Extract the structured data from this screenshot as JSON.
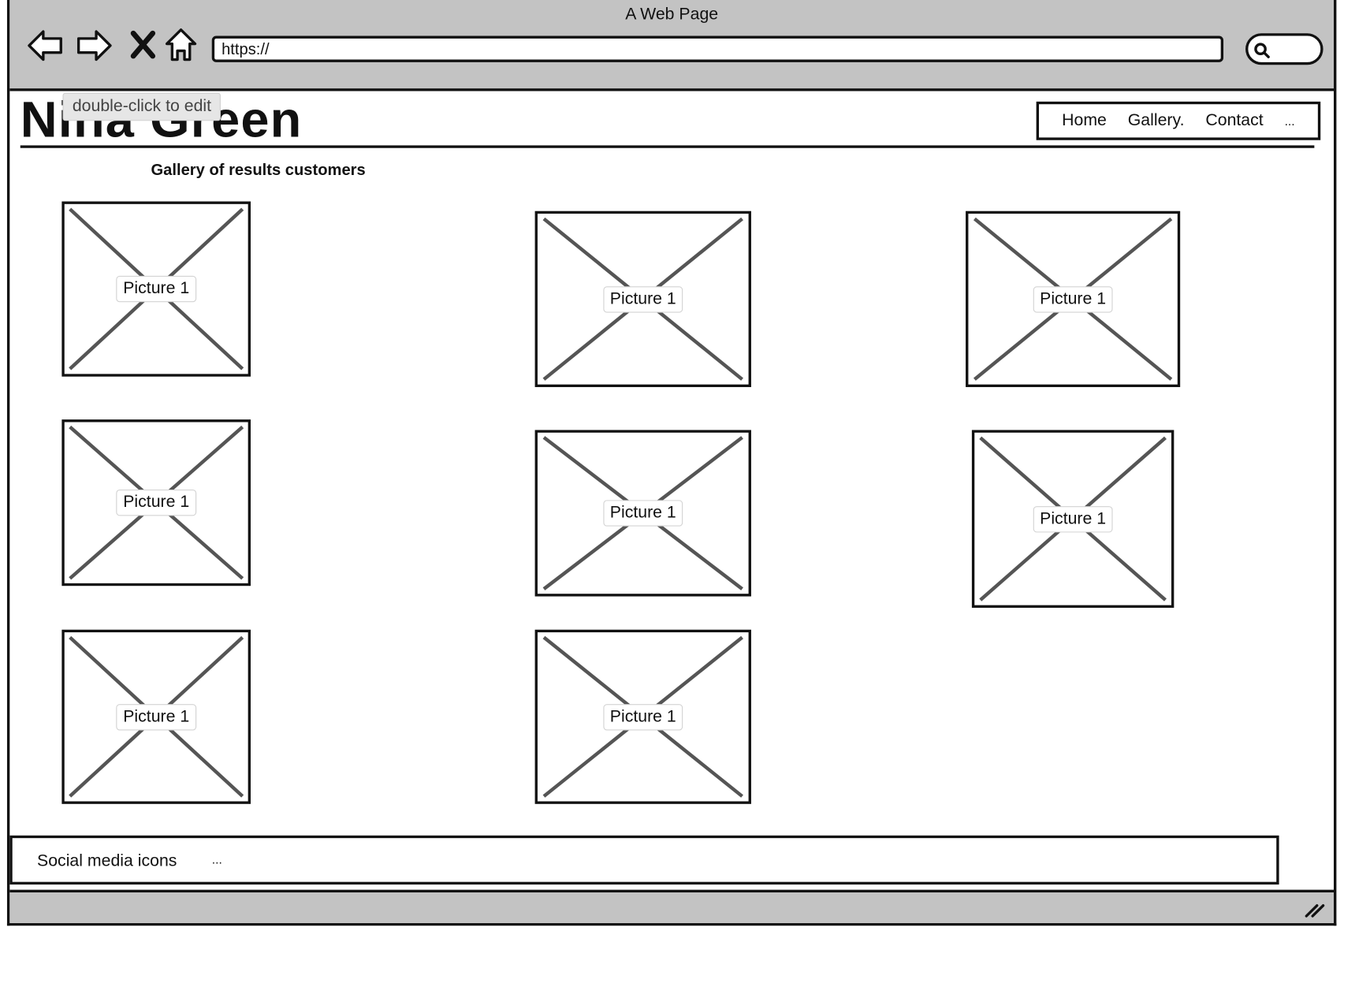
{
  "window": {
    "title": "A Web Page"
  },
  "browser": {
    "url": "https://"
  },
  "site": {
    "brand": "Nina Green",
    "tooltip": "double-click to edit"
  },
  "menu": {
    "home": "Home",
    "gallery": "Gallery.",
    "contact": "Contact",
    "more": "..."
  },
  "gallery": {
    "title": "Gallery of results customers",
    "pictures": [
      "Picture 1",
      "Picture 1",
      "Picture 1",
      "Picture 1",
      "Picture 1",
      "Picture 1",
      "Picture 1",
      "Picture 1"
    ]
  },
  "footer": {
    "social_label": "Social media icons",
    "more": "..."
  },
  "icons": [
    "back-arrow-icon",
    "forward-arrow-icon",
    "stop-icon",
    "home-icon",
    "search-icon",
    "resize-grip-icon",
    "image-placeholder-icon"
  ]
}
